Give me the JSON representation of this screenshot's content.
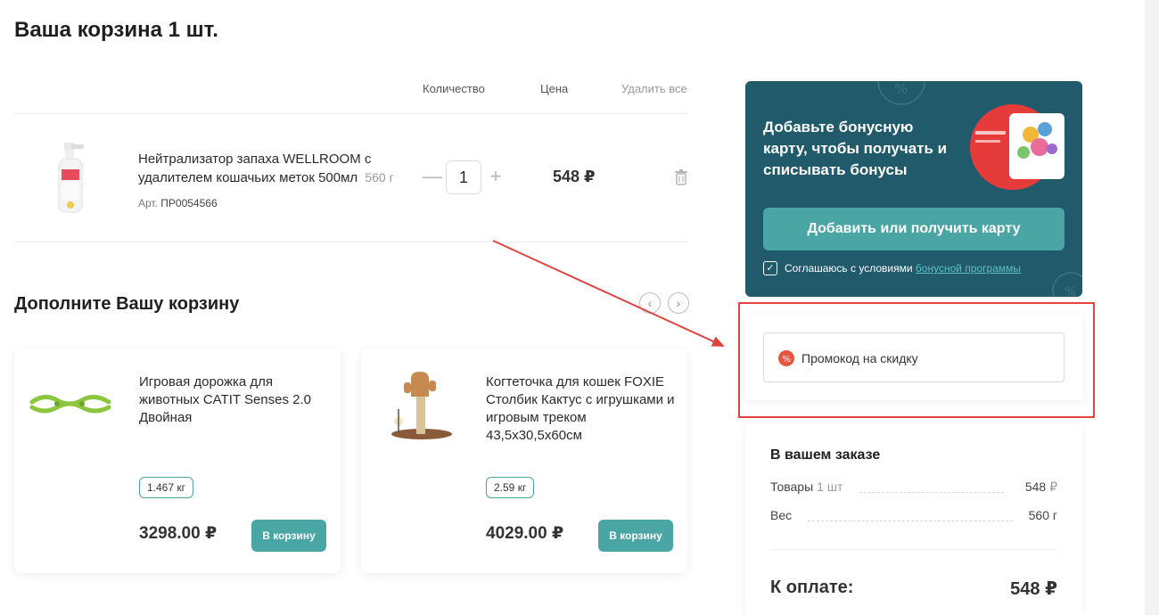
{
  "cart": {
    "title": "Ваша корзина 1 шт.",
    "columns": {
      "quantity": "Количество",
      "price": "Цена",
      "delete_all": "Удалить все"
    },
    "item": {
      "name": "Нейтрализатор запаха WELLROOM с удалителем кошачьих меток 500мл",
      "weight": "560 г",
      "article_label": "Арт.",
      "article": "ПР0054566",
      "quantity": "1",
      "minus": "—",
      "plus": "+",
      "price": "548 ₽"
    }
  },
  "upsell": {
    "title": "Дополните Вашу корзину",
    "prev": "‹",
    "next": "›",
    "products": [
      {
        "name": "Игровая дорожка для животных CATIT Senses 2.0 Двойная",
        "weight": "1.467 кг",
        "price": "3298.00 ₽",
        "button": "В корзину"
      },
      {
        "name": "Когтеточка для кошек FOXIE Столбик Кактус с игрушками и игровым треком 43,5x30,5x60см",
        "weight": "2.59 кг",
        "price": "4029.00 ₽",
        "button": "В корзину"
      }
    ]
  },
  "bonus": {
    "text": "Добавьте бонусную карту, чтобы получать и списывать бонусы",
    "button": "Добавить или получить карту",
    "agree_text": "Соглашаюсь с условиями",
    "agree_link": "бонусной программы",
    "checked": "✓"
  },
  "promo": {
    "placeholder": "Промокод на скидку"
  },
  "summary": {
    "title": "В вашем заказе",
    "goods_label": "Товары",
    "goods_count": "1 шт",
    "goods_amount": "548",
    "currency": "₽",
    "weight_label": "Вес",
    "weight_value": "560 г",
    "total_label": "К оплате:",
    "total_value": "548 ₽"
  },
  "colors": {
    "accent": "#49a6a5",
    "bonus_bg": "#205a6b",
    "highlight": "#e0443e"
  }
}
